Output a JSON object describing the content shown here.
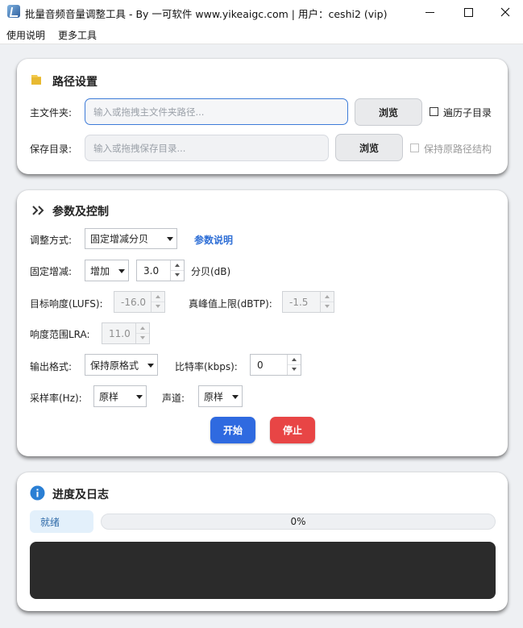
{
  "window": {
    "title": "批量音频音量调整工具 - By 一可软件 www.yikeaigc.com  |  用户：ceshi2  (vip)"
  },
  "menu": {
    "items": [
      "使用说明",
      "更多工具"
    ]
  },
  "path_settings": {
    "title": "路径设置",
    "main_folder_label": "主文件夹:",
    "main_folder_placeholder": "输入或拖拽主文件夹路径...",
    "main_folder_value": "",
    "browse_label_1": "浏览",
    "traverse_subdir_label": "遍历子目录",
    "traverse_subdir_checked": false,
    "save_dir_label": "保存目录:",
    "save_dir_placeholder": "输入或拖拽保存目录...",
    "save_dir_value": "",
    "browse_label_2": "浏览",
    "keep_structure_label": "保持原路径结构",
    "keep_structure_checked": false
  },
  "params": {
    "title": "参数及控制",
    "mode_label": "调整方式:",
    "mode_value": "固定增减分贝",
    "param_help_link": "参数说明",
    "fixed_label": "固定增减:",
    "fixed_dir_value": "增加",
    "fixed_amount": "3.0",
    "fixed_unit": "分贝(dB)",
    "lufs_label": "目标响度(LUFS):",
    "lufs_value": "-16.0",
    "true_peak_label": "真峰值上限(dBTP):",
    "true_peak_value": "-1.5",
    "lra_label": "响度范围LRA:",
    "lra_value": "11.0",
    "format_label": "输出格式:",
    "format_value": "保持原格式",
    "bitrate_label": "比特率(kbps):",
    "bitrate_value": "0",
    "samplerate_label": "采样率(Hz):",
    "samplerate_value": "原样",
    "channel_label": "声道:",
    "channel_value": "原样",
    "start_label": "开始",
    "stop_label": "停止"
  },
  "progress": {
    "title": "进度及日志",
    "status": "就绪",
    "percent_text": "0%",
    "fraction": 0.0
  },
  "colors": {
    "start_button": "#2f6ae0",
    "stop_button": "#e84545",
    "accent": "#3d7bd8",
    "log_background": "#2b2b2b"
  }
}
